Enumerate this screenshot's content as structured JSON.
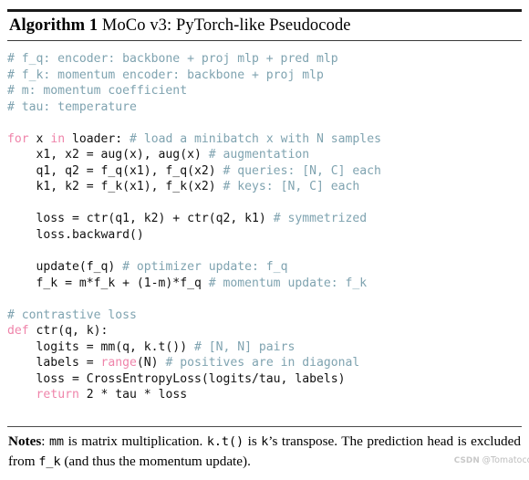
{
  "title": {
    "label": "Algorithm 1",
    "caption": " MoCo v3: PyTorch-like Pseudocode"
  },
  "colors": {
    "comment": "#7fa3b0",
    "keyword": "#ef84aa",
    "text": "#111111",
    "rule": "#1a1a1a",
    "background": "#ffffff",
    "watermark": "#b9b9b9"
  },
  "code": {
    "language": "python",
    "lines": [
      {
        "tokens": [
          {
            "t": "comment",
            "s": "# f_q: encoder: backbone + proj mlp + pred mlp"
          }
        ]
      },
      {
        "tokens": [
          {
            "t": "comment",
            "s": "# f_k: momentum encoder: backbone + proj mlp"
          }
        ]
      },
      {
        "tokens": [
          {
            "t": "comment",
            "s": "# m: momentum coefficient"
          }
        ]
      },
      {
        "tokens": [
          {
            "t": "comment",
            "s": "# tau: temperature"
          }
        ]
      },
      {
        "tokens": []
      },
      {
        "tokens": [
          {
            "t": "kw",
            "s": "for"
          },
          {
            "t": "plain",
            "s": " x "
          },
          {
            "t": "kw",
            "s": "in"
          },
          {
            "t": "plain",
            "s": " loader: "
          },
          {
            "t": "comment",
            "s": "# load a minibatch x with N samples"
          }
        ]
      },
      {
        "tokens": [
          {
            "t": "plain",
            "s": "    x1, x2 = aug(x), aug(x) "
          },
          {
            "t": "comment",
            "s": "# augmentation"
          }
        ]
      },
      {
        "tokens": [
          {
            "t": "plain",
            "s": "    q1, q2 = f_q(x1), f_q(x2) "
          },
          {
            "t": "comment",
            "s": "# queries: [N, C] each"
          }
        ]
      },
      {
        "tokens": [
          {
            "t": "plain",
            "s": "    k1, k2 = f_k(x1), f_k(x2) "
          },
          {
            "t": "comment",
            "s": "# keys: [N, C] each"
          }
        ]
      },
      {
        "tokens": []
      },
      {
        "tokens": [
          {
            "t": "plain",
            "s": "    loss = ctr(q1, k2) + ctr(q2, k1) "
          },
          {
            "t": "comment",
            "s": "# symmetrized"
          }
        ]
      },
      {
        "tokens": [
          {
            "t": "plain",
            "s": "    loss.backward()"
          }
        ]
      },
      {
        "tokens": []
      },
      {
        "tokens": [
          {
            "t": "plain",
            "s": "    update(f_q) "
          },
          {
            "t": "comment",
            "s": "# optimizer update: f_q"
          }
        ]
      },
      {
        "tokens": [
          {
            "t": "plain",
            "s": "    f_k = m*f_k + (1-m)*f_q "
          },
          {
            "t": "comment",
            "s": "# momentum update: f_k"
          }
        ]
      },
      {
        "tokens": []
      },
      {
        "tokens": [
          {
            "t": "comment",
            "s": "# contrastive loss"
          }
        ]
      },
      {
        "tokens": [
          {
            "t": "kw",
            "s": "def"
          },
          {
            "t": "plain",
            "s": " ctr(q, k):"
          }
        ]
      },
      {
        "tokens": [
          {
            "t": "plain",
            "s": "    logits = mm(q, k.t()) "
          },
          {
            "t": "comment",
            "s": "# [N, N] pairs"
          }
        ]
      },
      {
        "tokens": [
          {
            "t": "plain",
            "s": "    labels = "
          },
          {
            "t": "kw",
            "s": "range"
          },
          {
            "t": "plain",
            "s": "(N) "
          },
          {
            "t": "comment",
            "s": "# positives are in diagonal"
          }
        ]
      },
      {
        "tokens": [
          {
            "t": "plain",
            "s": "    loss = CrossEntropyLoss(logits/tau, labels)"
          }
        ]
      },
      {
        "tokens": [
          {
            "t": "plain",
            "s": "    "
          },
          {
            "t": "kw",
            "s": "return"
          },
          {
            "t": "plain",
            "s": " 2 * tau * loss"
          }
        ]
      }
    ]
  },
  "notes": {
    "label": "Notes",
    "segments": [
      {
        "t": "text",
        "s": ": "
      },
      {
        "t": "mono",
        "s": "mm"
      },
      {
        "t": "text",
        "s": " is matrix multiplication. "
      },
      {
        "t": "mono",
        "s": "k.t()"
      },
      {
        "t": "text",
        "s": " is "
      },
      {
        "t": "mono",
        "s": "k"
      },
      {
        "t": "text",
        "s": "’s transpose. The prediction head is excluded from "
      },
      {
        "t": "mono",
        "s": "f_k"
      },
      {
        "t": "text",
        "s": " (and thus the momentum update)."
      }
    ],
    "plain_text": "Notes: mm is matrix multiplication. k.t() is k’s transpose. The prediction head is excluded from f_k (and thus the momentum update)."
  },
  "watermark": {
    "mark": "CSDN",
    "handle": "@Tomatoccc"
  }
}
